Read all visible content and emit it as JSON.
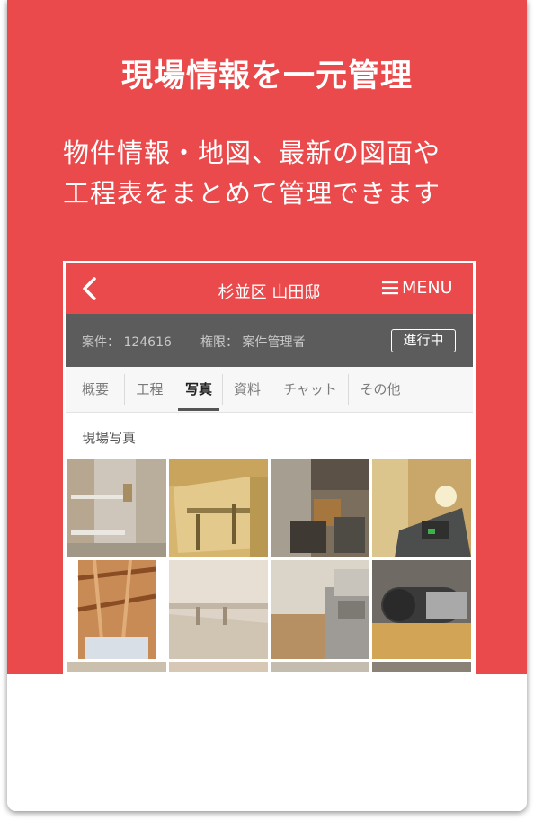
{
  "hero": {
    "title": "現場情報を一元管理",
    "subtitle_line1": "物件情報・地図、最新の図面や",
    "subtitle_line2": "工程表をまとめて管理できます"
  },
  "app": {
    "header": {
      "back_icon": "chevron-left-icon",
      "title": "杉並区 山田邸",
      "menu_label": "MENU",
      "menu_icon": "hamburger-icon"
    },
    "info": {
      "case_label": "案件： 124616",
      "role_label": "権限： 案件管理者",
      "status_badge": "進行中"
    },
    "tabs": [
      {
        "label": "概要",
        "active": false
      },
      {
        "label": "工程",
        "active": false
      },
      {
        "label": "写真",
        "active": true
      },
      {
        "label": "資料",
        "active": false
      },
      {
        "label": "チャット",
        "active": false
      },
      {
        "label": "その他",
        "active": false
      }
    ],
    "section_title": "現場写真",
    "photos": [
      "site-photo",
      "site-photo",
      "site-photo",
      "site-photo",
      "site-photo",
      "site-photo",
      "site-photo",
      "site-photo",
      "site-photo",
      "site-photo",
      "site-photo",
      "site-photo"
    ]
  },
  "colors": {
    "brand_red": "#ea4a4b",
    "info_bar": "#5c5c5c"
  }
}
